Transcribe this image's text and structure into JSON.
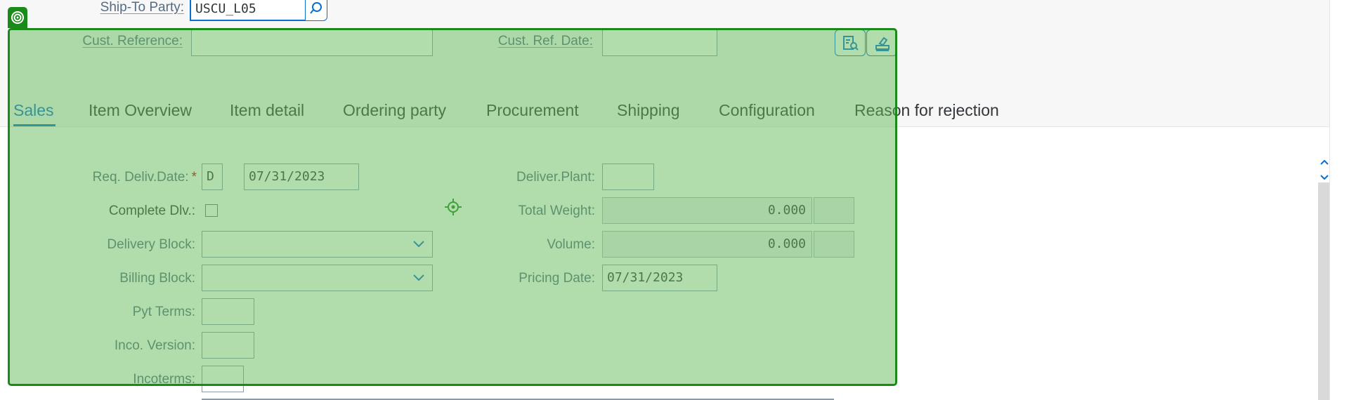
{
  "header": {
    "ship_to_label": "Ship-To Party:",
    "ship_to_value": "USCU_L05",
    "cust_ref_label": "Cust. Reference:",
    "cust_ref_value": "",
    "cust_ref_date_label": "Cust. Ref. Date:",
    "cust_ref_date_value": ""
  },
  "toolbar": {
    "icons": [
      "document-search-icon",
      "clear-entries-icon"
    ]
  },
  "tabs": [
    {
      "label": "Sales",
      "selected": true
    },
    {
      "label": "Item Overview"
    },
    {
      "label": "Item detail"
    },
    {
      "label": "Ordering party"
    },
    {
      "label": "Procurement"
    },
    {
      "label": "Shipping"
    },
    {
      "label": "Configuration"
    },
    {
      "label": "Reason for rejection"
    }
  ],
  "sales": {
    "req_deliv_date_label": "Req. Deliv.Date:",
    "req_deliv_date_required": "*",
    "req_deliv_date_type": "D",
    "req_deliv_date_value": "07/31/2023",
    "complete_dlv_label": "Complete Dlv.:",
    "complete_dlv_checked": false,
    "delivery_block_label": "Delivery Block:",
    "delivery_block_value": "",
    "billing_block_label": "Billing Block:",
    "billing_block_value": "",
    "pyt_terms_label": "Pyt Terms:",
    "pyt_terms_value": "",
    "inco_version_label": "Inco. Version:",
    "inco_version_value": "",
    "incoterms_label": "Incoterms:",
    "incoterms_value": "",
    "deliver_plant_label": "Deliver.Plant:",
    "deliver_plant_value": "",
    "total_weight_label": "Total Weight:",
    "total_weight_value": "0.000",
    "total_weight_unit": "",
    "volume_label": "Volume:",
    "volume_value": "0.000",
    "volume_unit": "",
    "pricing_date_label": "Pricing Date:",
    "pricing_date_value": "07/31/2023"
  },
  "colors": {
    "accent": "#0a6ed1",
    "overlay_fill": "#64b95a",
    "overlay_border": "#1a8a1a",
    "required": "#bb0000"
  }
}
